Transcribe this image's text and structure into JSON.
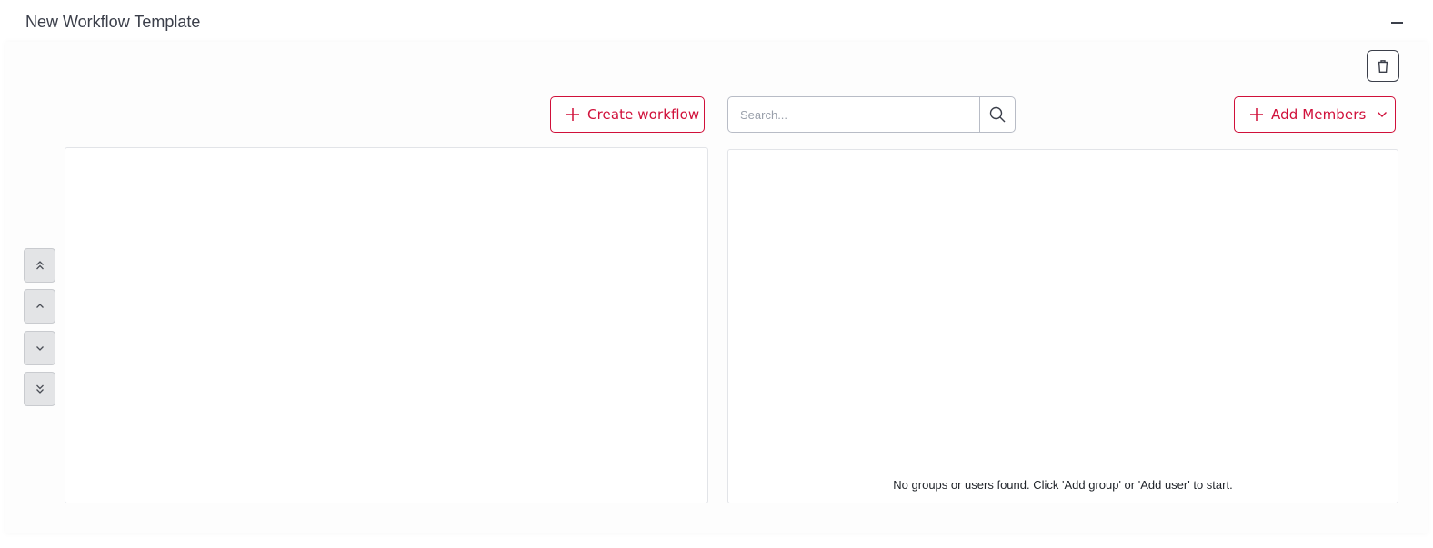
{
  "header": {
    "title": "New Workflow Template"
  },
  "toolbar": {
    "create_workflow_label": "Create workflow",
    "add_members_label": "Add Members",
    "search_placeholder": "Search..."
  },
  "members": {
    "empty_message": "No groups or users found. Click 'Add group' or 'Add user' to start."
  },
  "colors": {
    "accent": "#d0103a",
    "text": "#3b3f4a"
  },
  "icons": {
    "minimize": "minimize-icon",
    "delete": "trash-icon",
    "search": "search-icon",
    "plus": "plus-icon",
    "chevron": "chevron-down-icon",
    "move_top": "double-chevron-up-icon",
    "move_up": "chevron-up-icon",
    "move_down": "chevron-down-icon",
    "move_bottom": "double-chevron-down-icon"
  }
}
